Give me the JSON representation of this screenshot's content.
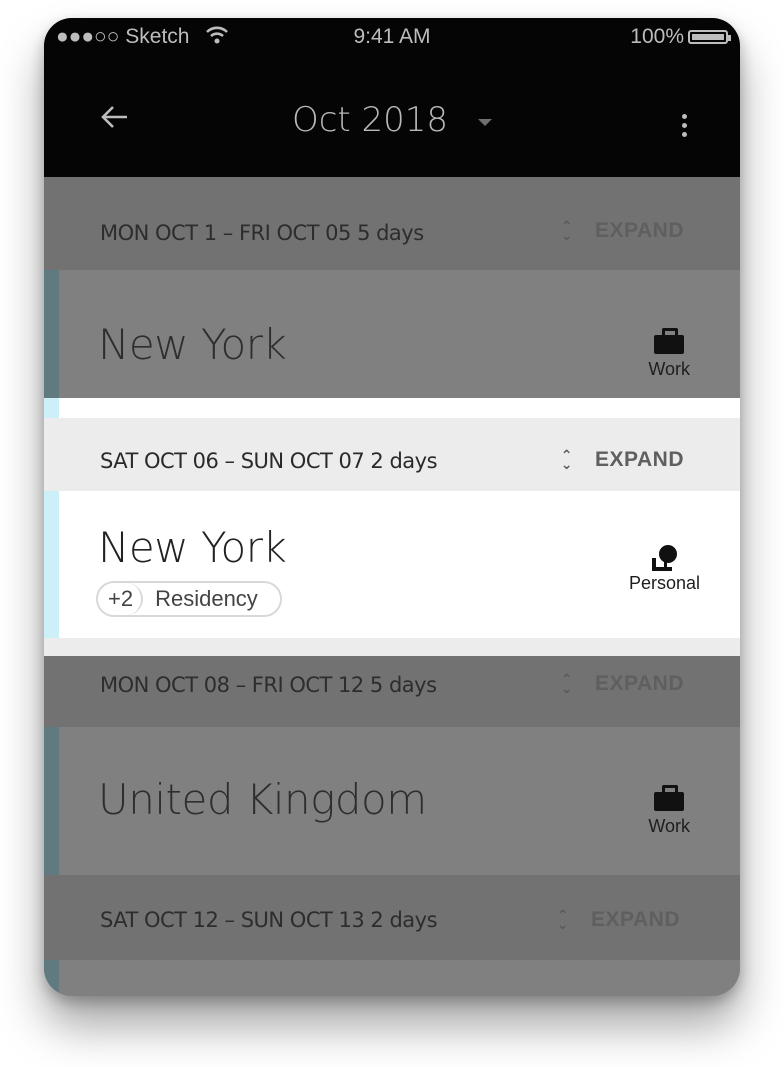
{
  "status_bar": {
    "carrier": "●●●○○ Sketch",
    "time": "9:41 AM",
    "battery": "100%"
  },
  "app_bar": {
    "title": "Oct 2018"
  },
  "periods": [
    {
      "range": "MON OCT 1  –  FRI OCT 05   5 days",
      "expand_label": "EXPAND",
      "place": "New York",
      "trip_type": "Work",
      "icon": "briefcase-icon"
    },
    {
      "range": "SAT OCT 06  –  SUN OCT 07    2 days",
      "expand_label": "EXPAND",
      "place": "New York",
      "tag_count": "+2",
      "tag_label": "Residency",
      "trip_type": "Personal",
      "icon": "person-icon"
    },
    {
      "range": "MON OCT 08  –  FRI OCT 12    5 days",
      "expand_label": "EXPAND",
      "place": "United Kingdom",
      "trip_type": "Work",
      "icon": "briefcase-icon"
    },
    {
      "range": "SAT OCT 12  –  SUN OCT 13    2 days",
      "expand_label": "EXPAND"
    }
  ],
  "colors": {
    "app_bar_bg": "#050505",
    "overlay_bg": "#808080",
    "card_stripe": "#617a80",
    "highlight_stripe": "#cdeff8"
  }
}
